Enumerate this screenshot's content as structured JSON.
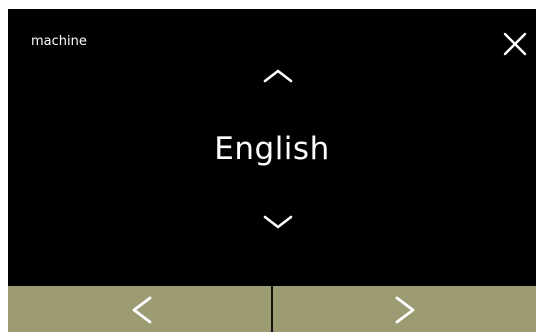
{
  "screen": {
    "title": "machine",
    "current_value": "English"
  },
  "icons": {
    "close": "close-icon",
    "up": "chevron-up-icon",
    "down": "chevron-down-icon",
    "prev": "chevron-left-icon",
    "next": "chevron-right-icon"
  },
  "colors": {
    "background": "#000000",
    "text": "#ffffff",
    "nav_bar": "#9c9b72"
  }
}
